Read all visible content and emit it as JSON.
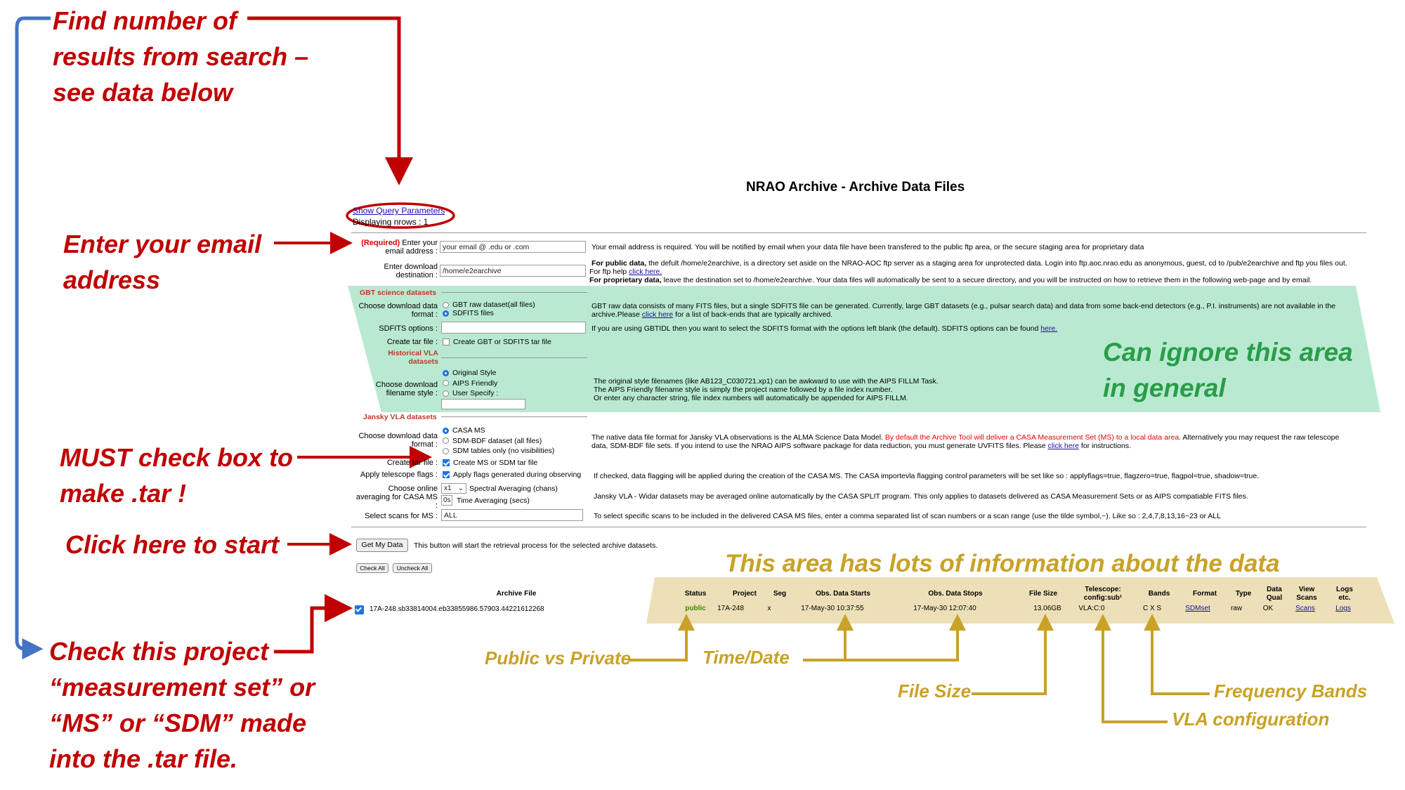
{
  "page": {
    "title": "NRAO Archive - Archive Data Files",
    "show_query_link": "Show Query Parameters",
    "displaying": "Displaying nrows : 1"
  },
  "annotations": {
    "find_number_l1": "Find number of",
    "find_number_l2": "results from search –",
    "find_number_l3": "see data below",
    "email_l1": "Enter your email",
    "email_l2": "address",
    "must_l1": "MUST check box to",
    "must_l2": "make .tar !",
    "click_start": "Click here to start",
    "check_l1": "Check this project",
    "check_l2": "“measurement set” or",
    "check_l3": "“MS” or “SDM” made",
    "check_l4": "into the .tar file.",
    "ignore_l1": "Can ignore this area",
    "ignore_l2": "in general",
    "info_area": "This area has lots of information about the data",
    "public_private": "Public vs Private",
    "time_date": "Time/Date",
    "file_size": "File Size",
    "freq_bands": "Frequency Bands",
    "vla_config": "VLA configuration"
  },
  "form": {
    "email_required": "(Required)",
    "email_label": " Enter your email address :",
    "email_placeholder": "your email @ .edu or .com",
    "email_help": "Your email address is required. You will be notified by email when your data file have been transfered to the public ftp area, or the secure staging area for proprietary data",
    "dest_label": "Enter download destination :",
    "dest_value": "/home/e2earchive",
    "dest_help_public_bold": "For public data,",
    "dest_help_public": " the defult /home/e2earchive, is a directory set aside on the NRAO-AOC ftp server as a staging area for unprotected data. Login into ftp.aoc.nrao.edu as anonymous, guest, cd to /pub/e2earchive and ftp you files out.",
    "dest_help_ftp": "For ftp help ",
    "dest_help_ftp_link": "click here.",
    "dest_help_prop_bold": "For proprietary data,",
    "dest_help_prop": " leave the destination set to /home/e2earchive. Your data files will automatically be sent to a secure directory, and you will be instructed on how to retrieve them in the following web-page and by email.",
    "gbt_header": "GBT science datasets",
    "gbt_format_label": "Choose download data format :",
    "gbt_opt1": "GBT raw dataset(all files)",
    "gbt_opt2": "SDFITS files",
    "gbt_help": "GBT raw data consists of many FITS files, but a single SDFITS file can be generated. Currently, large GBT datasets (e.g., pulsar search data) and data from some back-end detectors (e.g., P.I. instruments) are not available in the archive.Please ",
    "gbt_help_link": "click here",
    "gbt_help_end": " for a list of back-ends that are typically archived.",
    "sdfits_label": "SDFITS options :",
    "sdfits_help": "If you are using GBTIDL then you want to select the SDFITS format with the options left blank (the default). SDFITS options can be found ",
    "sdfits_help_link": "here.",
    "gbt_tar_label": "Create tar file :",
    "gbt_tar_opt": "Create GBT or SDFITS tar file",
    "hist_header_l1": "Historical VLA",
    "hist_header_l2": "datasets",
    "hist_style_label": "Choose download filename style :",
    "hist_opt1": "Original Style",
    "hist_opt2": "AIPS Friendly",
    "hist_opt3": "User Specify :",
    "hist_help_l1": "The original style filenames (like AB123_C030721.xp1) can be awkward to use with the AIPS FILLM Task.",
    "hist_help_l2": "The AIPS Friendly filename style is simply the project name followed by a file index number.",
    "hist_help_l3": "Or enter any character string, file index numbers will automatically be appended for AIPS FILLM.",
    "jansky_header": "Jansky VLA datasets",
    "jansky_format_label": "Choose download data format :",
    "jansky_opt1": "CASA MS",
    "jansky_opt2": "SDM-BDF dataset (all files)",
    "jansky_opt3": "SDM tables only (no visibilities)",
    "jansky_help_a": "The native data file format for Jansky VLA observations is the ALMA Science Data Model. ",
    "jansky_help_red": "By default the Archive Tool will deliver a CASA Measurement Set (MS) to a local data area.",
    "jansky_help_b": " Alternatively you may request the raw telescope",
    "jansky_help_c": "data, SDM-BDF file sets. If you intend to use the NRAO AIPS software package for data reduction, you must generate UVFITS files. Please ",
    "jansky_help_link": "click here",
    "jansky_help_d": " for instructions.",
    "jansky_tar_label": "Create tar file :",
    "jansky_tar_opt": "Create MS or SDM tar file",
    "flags_label": "Apply telescope flags :",
    "flags_opt": "Apply flags generated during observing",
    "flags_help": "If checked, data flagging will be applied during the creation of the CASA MS. The CASA importevla flagging control parameters will be set like so : applyflags=true, flagzero=true, flagpol=true, shadow=true.",
    "avg_label": "Choose online averaging for CASA MS :",
    "avg_select": "x1",
    "avg_spectral": "Spectral Averaging (chans)",
    "avg_time_value": "0s",
    "avg_time": "Time Averaging (secs)",
    "avg_help": "Jansky VLA - Widar datasets may be averaged online automatically by the CASA SPLIT program. This only applies to datasets delivered as CASA Measurement Sets or as AIPS compatiable FITS files.",
    "scans_label": "Select scans for MS :",
    "scans_value": "ALL",
    "scans_help": "To select specific scans to be included in the delivered CASA MS files, enter a comma separated list of scan numbers or a scan range (use the tilde symbol,~). Like so : 2,4,7,8,13,16~23 or ALL",
    "get_data": "Get My Data",
    "get_data_help": "This button will start the retrieval process for the selected archive datasets.",
    "check_all": "Check All",
    "uncheck_all": "Uncheck All"
  },
  "table": {
    "headers": {
      "archive_file": "Archive File",
      "status": "Status",
      "project": "Project",
      "seg": "Seg",
      "obs_start": "Obs. Data Starts",
      "obs_stop": "Obs. Data Stops",
      "file_size": "File Size",
      "telescope_l1": "Telescope:",
      "telescope_l2": "config:sub¹",
      "bands": "Bands",
      "format": "Format",
      "type": "Type",
      "data_qual_l1": "Data",
      "data_qual_l2": "Qual",
      "view_scans_l1": "View",
      "view_scans_l2": "Scans",
      "logs_l1": "Logs",
      "logs_l2": "etc."
    },
    "row": {
      "archive_file": "17A-248.sb33814004.eb33855986.57903.44221612268",
      "status": "public",
      "project": "17A-248",
      "seg": "x",
      "obs_start": "17-May-30 10:37:55",
      "obs_stop": "17-May-30 12:07:40",
      "file_size": "13.06GB",
      "telescope": "VLA:C:0",
      "bands": "C X S",
      "format": "SDMset",
      "type": "raw",
      "data_qual": "OK",
      "view_scans": "Scans",
      "logs": "Logs"
    }
  },
  "colors": {
    "annotation_red": "#c00000",
    "annotation_gold": "#c9a227",
    "annotation_green": "#2a9d4a",
    "ignore_area_bg": "#b9ead1",
    "info_area_bg": "#ede0b8",
    "blue_bracket": "#4472c4"
  }
}
